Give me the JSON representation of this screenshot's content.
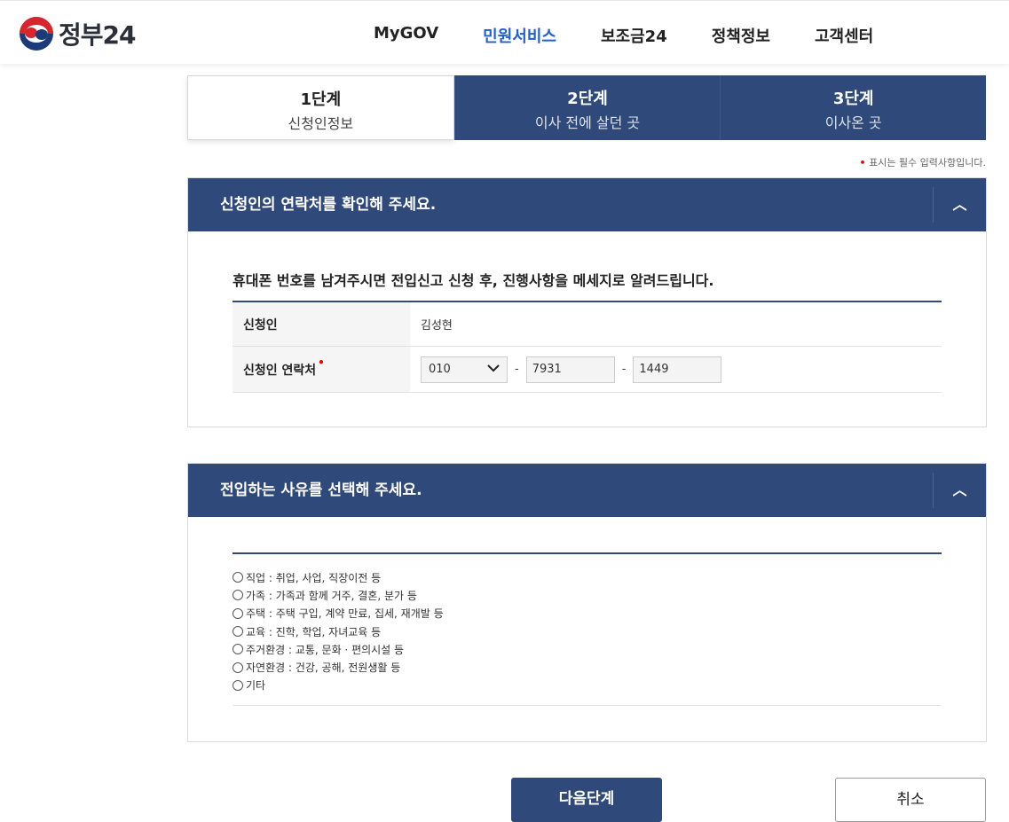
{
  "header": {
    "logo_text": "정부24",
    "menu": [
      "MyGOV",
      "민원서비스",
      "보조금24",
      "정책정보",
      "고객센터"
    ],
    "active_menu": "민원서비스"
  },
  "steps": [
    {
      "num": "1단계",
      "label": "신청인정보",
      "active": true
    },
    {
      "num": "2단계",
      "label": "이사 전에 살던 곳",
      "active": false
    },
    {
      "num": "3단계",
      "label": "이사온 곳",
      "active": false
    }
  ],
  "required_note": "표시는 필수 입력사항입니다.",
  "contact_section": {
    "title": "신청인의 연락처를 확인해 주세요.",
    "description": "휴대폰 번호를 남겨주시면 전입신고 신청 후, 진행사항을 메세지로 알려드립니다.",
    "applicant_label": "신청인",
    "applicant_value": "김성현",
    "phone_label": "신청인 연락처",
    "phone_prefix": "010",
    "phone_mid": "7931",
    "phone_last": "1449"
  },
  "reason_section": {
    "title": "전입하는 사유를 선택해 주세요.",
    "options": [
      "직업 : 취업, 사업, 직장이전 등",
      "가족 : 가족과 함께 거주, 결혼, 분가 등",
      "주택 : 주택 구입, 계약 만료, 집세, 재개발 등",
      "교육 : 진학, 학업, 자녀교육 등",
      "주거환경 : 교통, 문화 · 편의시설 등",
      "자연환경 : 건강, 공해, 전원생활 등",
      "기타"
    ]
  },
  "buttons": {
    "next": "다음단계",
    "cancel": "취소"
  },
  "colors": {
    "primary": "#2f4a7a",
    "active_menu": "#1e5fd6",
    "required": "#e00000"
  }
}
